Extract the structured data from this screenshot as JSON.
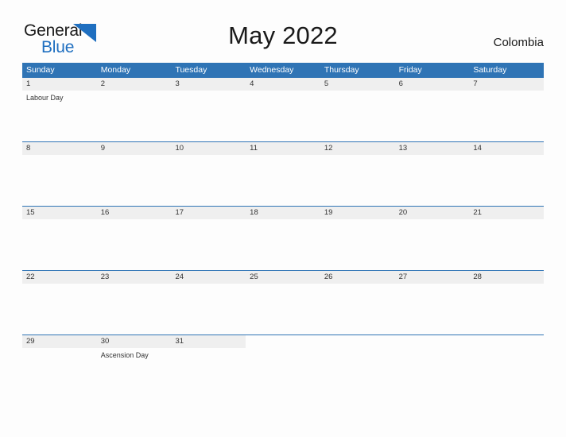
{
  "brand": {
    "name_part1": "General",
    "name_part2": "Blue",
    "triangle_icon": "triangle-icon",
    "accent_color": "#1f6fc0"
  },
  "header": {
    "title": "May 2022",
    "country": "Colombia"
  },
  "theme": {
    "header_blue": "#2f74b5",
    "date_band_gray": "#efefef",
    "page_background": "#fdfdfd",
    "text_color": "#333333"
  },
  "calendar": {
    "weekdays": [
      "Sunday",
      "Monday",
      "Tuesday",
      "Wednesday",
      "Thursday",
      "Friday",
      "Saturday"
    ],
    "weeks": [
      {
        "days": [
          {
            "date": "1",
            "event": "Labour Day"
          },
          {
            "date": "2",
            "event": ""
          },
          {
            "date": "3",
            "event": ""
          },
          {
            "date": "4",
            "event": ""
          },
          {
            "date": "5",
            "event": ""
          },
          {
            "date": "6",
            "event": ""
          },
          {
            "date": "7",
            "event": ""
          }
        ]
      },
      {
        "days": [
          {
            "date": "8",
            "event": ""
          },
          {
            "date": "9",
            "event": ""
          },
          {
            "date": "10",
            "event": ""
          },
          {
            "date": "11",
            "event": ""
          },
          {
            "date": "12",
            "event": ""
          },
          {
            "date": "13",
            "event": ""
          },
          {
            "date": "14",
            "event": ""
          }
        ]
      },
      {
        "days": [
          {
            "date": "15",
            "event": ""
          },
          {
            "date": "16",
            "event": ""
          },
          {
            "date": "17",
            "event": ""
          },
          {
            "date": "18",
            "event": ""
          },
          {
            "date": "19",
            "event": ""
          },
          {
            "date": "20",
            "event": ""
          },
          {
            "date": "21",
            "event": ""
          }
        ]
      },
      {
        "days": [
          {
            "date": "22",
            "event": ""
          },
          {
            "date": "23",
            "event": ""
          },
          {
            "date": "24",
            "event": ""
          },
          {
            "date": "25",
            "event": ""
          },
          {
            "date": "26",
            "event": ""
          },
          {
            "date": "27",
            "event": ""
          },
          {
            "date": "28",
            "event": ""
          }
        ]
      },
      {
        "days": [
          {
            "date": "29",
            "event": ""
          },
          {
            "date": "30",
            "event": "Ascension Day"
          },
          {
            "date": "31",
            "event": ""
          },
          {
            "date": "",
            "event": ""
          },
          {
            "date": "",
            "event": ""
          },
          {
            "date": "",
            "event": ""
          },
          {
            "date": "",
            "event": ""
          }
        ]
      }
    ]
  }
}
